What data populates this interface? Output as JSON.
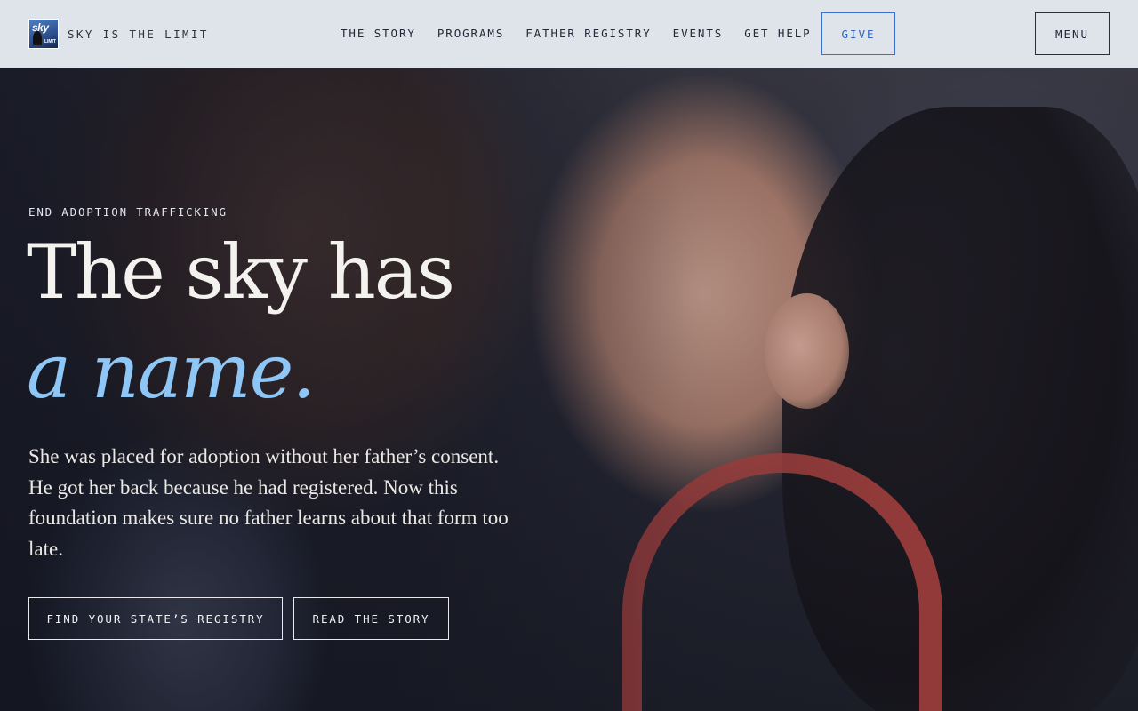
{
  "header": {
    "brand": {
      "logo_text": "sky",
      "logo_sub": "LIMIT",
      "name": "SKY IS THE LIMIT"
    },
    "nav": [
      {
        "label": "THE STORY"
      },
      {
        "label": "PROGRAMS"
      },
      {
        "label": "FATHER REGISTRY"
      },
      {
        "label": "EVENTS"
      },
      {
        "label": "GET HELP"
      }
    ],
    "give_label": "GIVE",
    "menu_label": "MENU"
  },
  "hero": {
    "eyebrow": "END ADOPTION TRAFFICKING",
    "headline_line1": "The sky has",
    "headline_line2": "a name.",
    "lede": "She was placed for adoption without her father’s consent. He got her back because he had registered. Now this foundation makes sure no father learns about that form too late.",
    "cta_primary": "FIND YOUR STATE’S REGISTRY",
    "cta_secondary": "READ THE STORY"
  },
  "colors": {
    "header_bg": "#dfe3ea",
    "accent_blue": "#8ec6f5",
    "give_blue": "#2f64c0",
    "headline": "#f4f2ee"
  }
}
